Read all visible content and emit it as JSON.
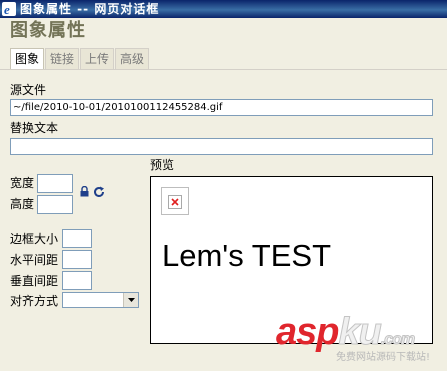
{
  "window": {
    "title": "图象属性  --  网页对话框"
  },
  "dialog": {
    "title": "图象属性"
  },
  "tabs": [
    {
      "label": "图象"
    },
    {
      "label": "链接"
    },
    {
      "label": "上传"
    },
    {
      "label": "高级"
    }
  ],
  "fields": {
    "source_label": "源文件",
    "source_value": "~/file/2010-10-01/2010100112455284.gif",
    "alt_label": "替换文本",
    "alt_value": "",
    "width_label": "宽度",
    "width_value": "",
    "height_label": "高度",
    "height_value": "",
    "border_label": "边框大小",
    "border_value": "",
    "hspace_label": "水平间距",
    "hspace_value": "",
    "vspace_label": "垂直间距",
    "vspace_value": "",
    "align_label": "对齐方式",
    "align_value": ""
  },
  "preview": {
    "label": "预览",
    "text": "Lem's TEST"
  },
  "watermark": {
    "logo_a": "asp",
    "logo_b": "ku",
    "logo_c": ".com",
    "subtitle": "免费网站源码下载站!"
  },
  "icons": {
    "app": "ie-icon",
    "lock": "lock-icon",
    "reset": "reset-size-icon",
    "dropdown": "chevron-down-icon",
    "broken_image": "broken-image-icon"
  },
  "colors": {
    "titlebar": "#0a246a",
    "dialog_bg": "#f1efe2",
    "dialog_title": "#737357",
    "watermark_red": "#e0262d"
  }
}
